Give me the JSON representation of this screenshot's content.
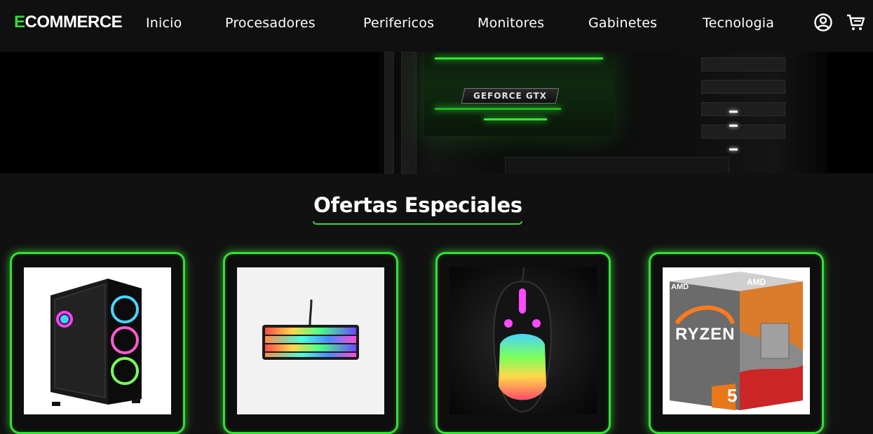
{
  "header": {
    "logo_first": "E",
    "logo_rest": "COMMERCE",
    "nav": [
      {
        "label": "Inicio"
      },
      {
        "label": "Procesadores"
      },
      {
        "label": "Perifericos"
      },
      {
        "label": "Monitores"
      },
      {
        "label": "Gabinetes"
      },
      {
        "label": "Tecnologia"
      }
    ],
    "icons": [
      "user-account-icon",
      "shopping-cart-icon"
    ]
  },
  "hero": {
    "gpu_label": "GEFORCE GTX"
  },
  "section": {
    "title": "Ofertas Especiales"
  },
  "products": [
    {
      "icon": "pc-case-image",
      "image_text": ""
    },
    {
      "icon": "keyboard-image",
      "image_text": ""
    },
    {
      "icon": "mouse-image",
      "image_text": ""
    },
    {
      "icon": "ryzen-box-image",
      "brand_front": "AMD",
      "brand_top": "AMD",
      "model": "RYZEN",
      "number": "5"
    }
  ],
  "colors": {
    "accent": "#39d63a",
    "background": "#111111",
    "navbar": "#101010"
  }
}
